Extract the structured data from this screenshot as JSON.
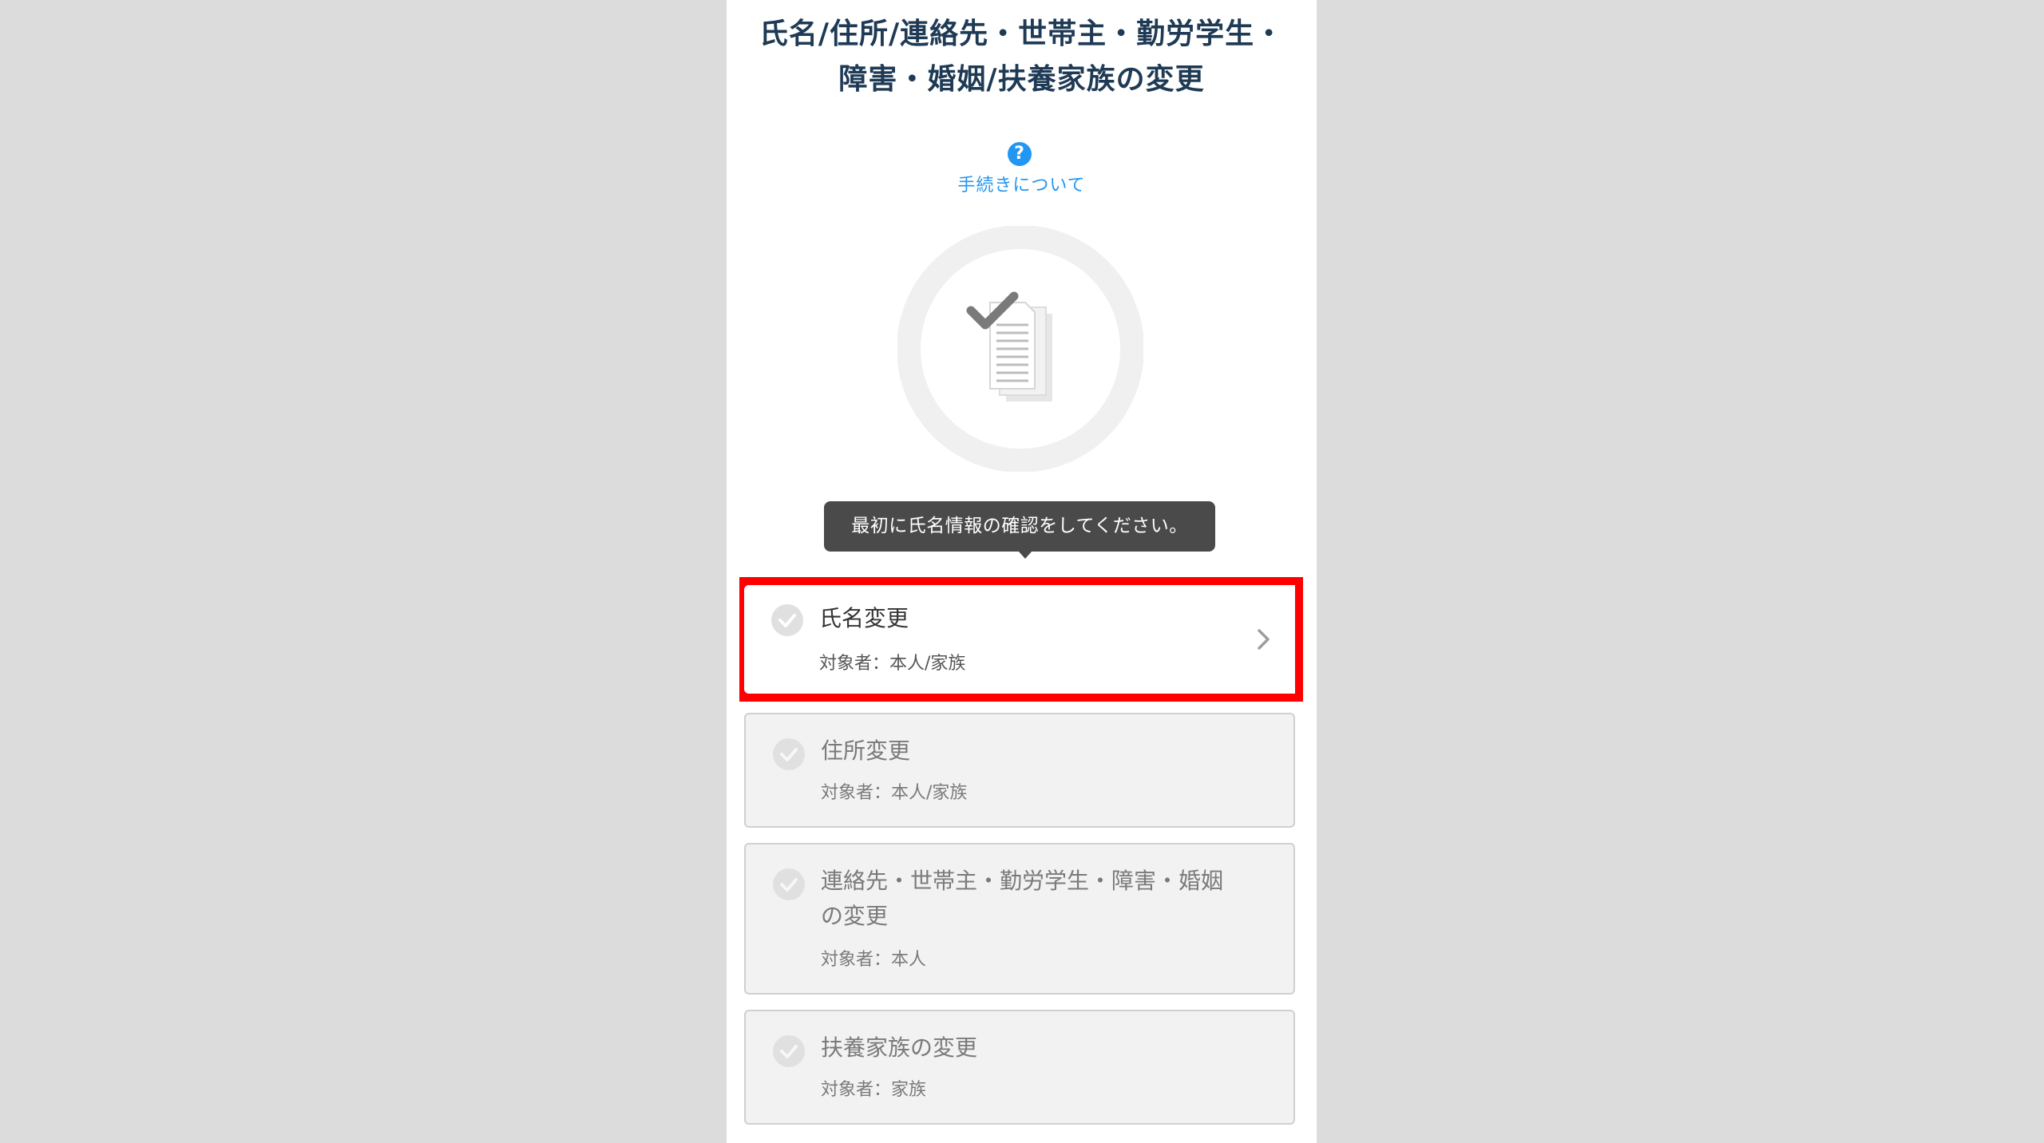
{
  "page": {
    "title_line1": "氏名/住所/連絡先・世帯主・勤労学生・",
    "title_line2": "障害・婚姻/扶養家族の変更"
  },
  "help": {
    "icon": "question-mark-icon",
    "icon_glyph": "?",
    "label": "手続きについて"
  },
  "illustration": {
    "icon": "checked-documents-icon"
  },
  "tooltip": {
    "text": "最初に氏名情報の確認をしてください。"
  },
  "menu": {
    "items": [
      {
        "title": "氏名変更",
        "target": "対象者：本人/家族",
        "state": "active",
        "icon": "check-circle-icon",
        "has_chevron": true
      },
      {
        "title": "住所変更",
        "target": "対象者：本人/家族",
        "state": "disabled",
        "icon": "check-circle-icon"
      },
      {
        "title": "連絡先・世帯主・勤労学生・障害・婚姻の変更",
        "target": "対象者：本人",
        "state": "disabled",
        "icon": "check-circle-icon"
      },
      {
        "title": "扶養家族の変更",
        "target": "対象者：家族",
        "state": "disabled",
        "icon": "check-circle-icon"
      }
    ]
  },
  "colors": {
    "background": "#dcdcdc",
    "title": "#1f3a55",
    "link": "#2196f3",
    "tooltip": "#4a4a4a",
    "highlight": "#ff0000",
    "disabled_card": "#f2f2f2"
  }
}
